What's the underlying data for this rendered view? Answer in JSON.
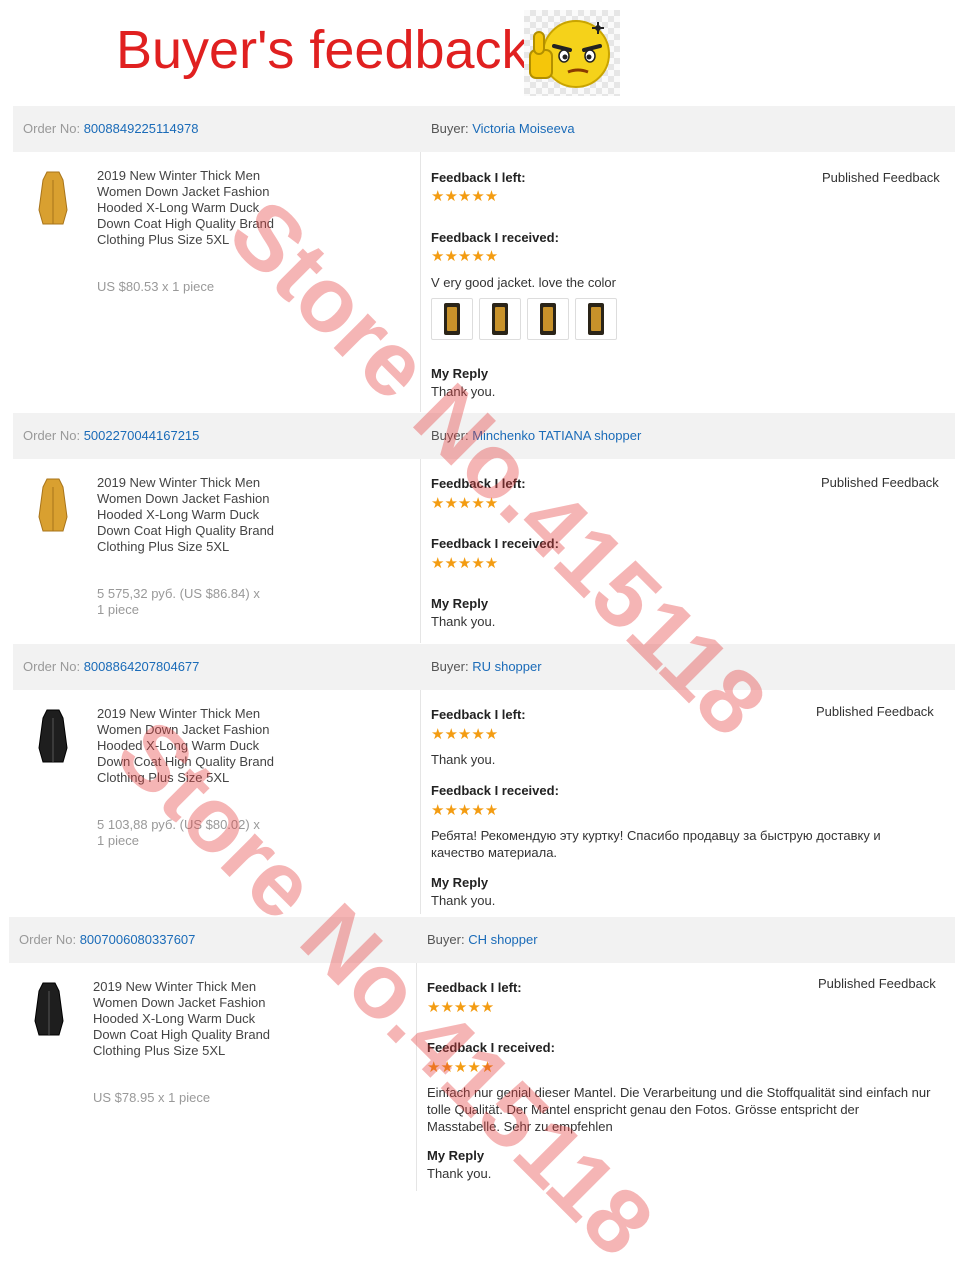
{
  "page_title": "Buyer's feedback",
  "watermark": "Store No.415118",
  "colors": {
    "title_red": "#e02020",
    "link_blue": "#1a6bb8",
    "star_orange": "#f39c12",
    "header_bg": "#f2f2f2"
  },
  "labels": {
    "order_no": "Order No:",
    "buyer": "Buyer:",
    "feedback_left": "Feedback I left:",
    "feedback_received": "Feedback I received:",
    "published": "Published Feedback",
    "my_reply": "My Reply",
    "stars": "★★★★★"
  },
  "orders": [
    {
      "order_no": "8008849225114978",
      "buyer": "Victoria Moiseeva",
      "product_title": "2019 New Winter Thick Men Women Down Jacket Fashion Hooded X-Long Warm Duck Down Coat High Quality Brand Clothing Plus Size 5XL",
      "price": "US $80.53 x 1 piece",
      "jacket_color": "#d9a030",
      "left_rating": 5,
      "received_rating": 5,
      "received_text": "V ery good jacket. love the color",
      "photo_icons": [
        "photo-thumb-icon",
        "photo-thumb-icon",
        "photo-thumb-icon",
        "photo-thumb-icon"
      ],
      "reply": "Thank you."
    },
    {
      "order_no": "5002270044167215",
      "buyer": "Minchenko TATIANA shopper",
      "product_title": "2019 New Winter Thick Men Women Down Jacket Fashion Hooded X-Long Warm Duck Down Coat High Quality Brand Clothing Plus Size 5XL",
      "price": "5 575,32 руб. (US $86.84) x 1 piece",
      "jacket_color": "#d9a030",
      "left_rating": 5,
      "received_rating": 5,
      "reply": "Thank you."
    },
    {
      "order_no": "8008864207804677",
      "buyer": "RU shopper",
      "product_title": "2019 New Winter Thick Men Women Down Jacket Fashion Hooded X-Long Warm Duck Down Coat High Quality Brand Clothing Plus Size 5XL",
      "price": "5 103,88 руб. (US $80.02) x 1 piece",
      "jacket_color": "#1e1e1e",
      "left_rating": 5,
      "left_text": "Thank you.",
      "received_rating": 5,
      "received_text": "Ребята! Рекомендую эту куртку! Спасибо продавцу за быструю доставку и качество материала.",
      "reply": "Thank you."
    },
    {
      "order_no": "8007006080337607",
      "buyer": "CH shopper",
      "product_title": "2019 New Winter Thick Men Women Down Jacket Fashion Hooded X-Long Warm Duck Down Coat High Quality Brand Clothing Plus Size 5XL",
      "price": "US $78.95 x 1 piece",
      "jacket_color": "#1e1e1e",
      "left_rating": 5,
      "received_rating": 5,
      "received_text": "Einfach nur genial dieser Mantel. Die Verarbeitung und die Stoffqualität sind einfach nur tolle Qualität. Der Mantel enspricht genau den Fotos. Grösse entspricht der Masstabelle. Sehr zu empfehlen",
      "reply": "Thank you."
    }
  ]
}
